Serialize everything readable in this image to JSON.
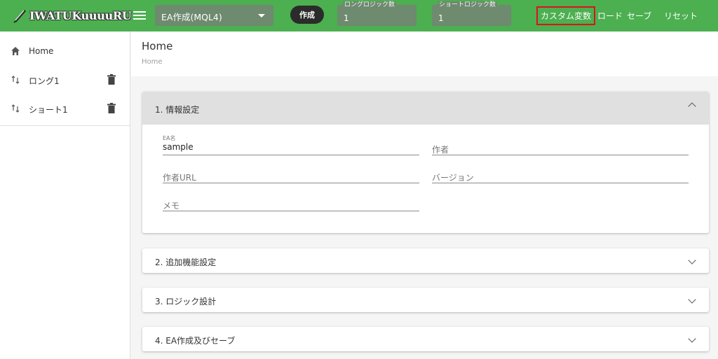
{
  "topbar": {
    "logo_text": "IWATUKuuuuRU",
    "ea_select": "EA作成(MQL4)",
    "create_label": "作成",
    "long_logic": {
      "label": "ロングロジック数",
      "value": "1"
    },
    "short_logic": {
      "label": "ショートロジック数",
      "value": "1"
    },
    "custom_var_label": "カスタム変数",
    "load_label": "ロード",
    "save_label": "セーブ",
    "reset_label": "リセット",
    "highlight_color": "#d8141c",
    "bar_color": "#4caf50"
  },
  "sidebar": {
    "items": [
      {
        "label": "Home",
        "icon": "home-icon"
      },
      {
        "label": "ロング1",
        "icon": "sort-arrows-icon"
      },
      {
        "label": "ショート1",
        "icon": "sort-arrows-icon"
      }
    ]
  },
  "header": {
    "title": "Home",
    "breadcrumb": "Home"
  },
  "panels": [
    {
      "title": "1.  情報設定",
      "expanded": true,
      "fields": {
        "ea_name": {
          "label": "EA名",
          "value": "sample"
        },
        "author": {
          "placeholder": "作者"
        },
        "author_url": {
          "placeholder": "作者URL"
        },
        "version": {
          "placeholder": "バージョン"
        },
        "memo": {
          "placeholder": "メモ"
        }
      }
    },
    {
      "title": "2.  追加機能設定",
      "expanded": false
    },
    {
      "title": "3.  ロジック設計",
      "expanded": false
    },
    {
      "title": "4.  EA作成及びセーブ",
      "expanded": false
    }
  ]
}
